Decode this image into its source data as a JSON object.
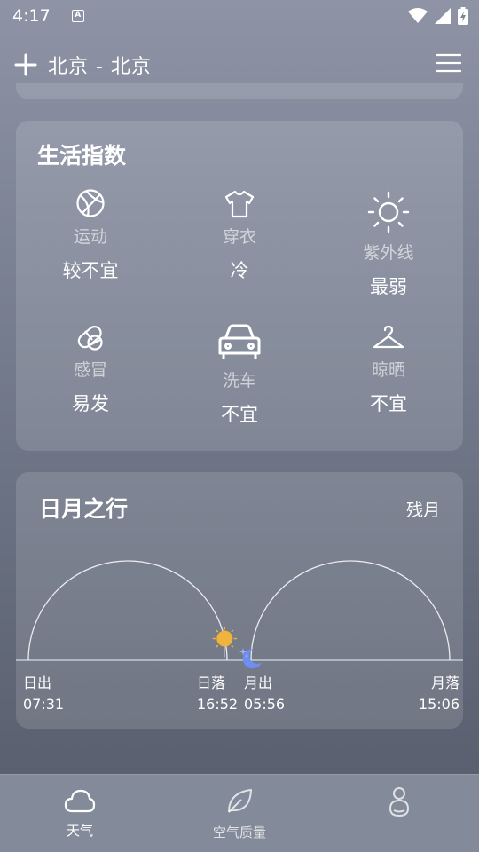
{
  "status_bar": {
    "time": "4:17",
    "notif_letter": "A"
  },
  "header": {
    "city": "北京 - 北京"
  },
  "life_index": {
    "title": "生活指数",
    "items": [
      {
        "label": "运动",
        "value": "较不宜",
        "icon": "basketball-icon"
      },
      {
        "label": "穿衣",
        "value": "冷",
        "icon": "tshirt-icon"
      },
      {
        "label": "紫外线",
        "value": "最弱",
        "icon": "sun-icon"
      },
      {
        "label": "感冒",
        "value": "易发",
        "icon": "pill-icon"
      },
      {
        "label": "洗车",
        "value": "不宜",
        "icon": "car-icon"
      },
      {
        "label": "晾晒",
        "value": "不宜",
        "icon": "hanger-icon"
      }
    ]
  },
  "sun_moon": {
    "title": "日月之行",
    "moon_phase": "残月",
    "sunrise": {
      "label": "日出",
      "time": "07:31"
    },
    "sunset": {
      "label": "日落",
      "time": "16:52"
    },
    "moonrise": {
      "label": "月出",
      "time": "05:56"
    },
    "moonset": {
      "label": "月落",
      "time": "15:06"
    },
    "sun_progress": 1.0,
    "moon_progress": 0.0,
    "colors": {
      "sun": "#f0b43c",
      "moon": "#6f8ef5"
    }
  },
  "tabbar": {
    "tabs": [
      {
        "label": "天气",
        "icon": "cloud-icon",
        "active": true
      },
      {
        "label": "空气质量",
        "icon": "leaf-icon",
        "active": false
      },
      {
        "label": "",
        "icon": "person-icon",
        "active": false
      }
    ]
  }
}
